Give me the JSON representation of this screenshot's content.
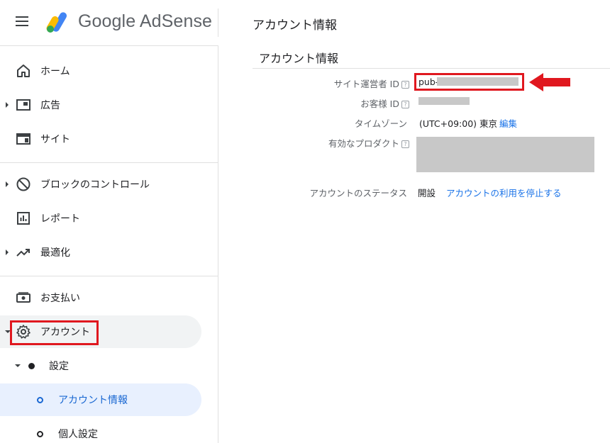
{
  "app": {
    "logo_text": "Google AdSense"
  },
  "header": {
    "title": "アカウント情報"
  },
  "sidebar": {
    "items": [
      {
        "label": "ホーム",
        "icon": "home-icon"
      },
      {
        "label": "広告",
        "icon": "ads-icon"
      },
      {
        "label": "サイト",
        "icon": "sites-icon"
      },
      {
        "label": "ブロックのコントロール",
        "icon": "block-icon"
      },
      {
        "label": "レポート",
        "icon": "report-icon"
      },
      {
        "label": "最適化",
        "icon": "trending-icon"
      },
      {
        "label": "お支払い",
        "icon": "payment-icon"
      },
      {
        "label": "アカウント",
        "icon": "gear-icon"
      }
    ],
    "sub_group": "設定",
    "sub_items": [
      {
        "label": "アカウント情報"
      },
      {
        "label": "個人設定"
      }
    ]
  },
  "main": {
    "title": "アカウント情報",
    "publisher_id_label": "サイト運営者 ID",
    "publisher_id_prefix": "pub-",
    "customer_id_label": "お客様 ID",
    "timezone_label": "タイムゾーン",
    "timezone_value": "(UTC+09:00) 東京",
    "timezone_edit": "編集",
    "products_label": "有効なプロダクト",
    "status_label": "アカウントのステータス",
    "status_value": "開設",
    "status_link": "アカウントの利用を停止する",
    "help_glyph": "?"
  },
  "colors": {
    "highlight": "#e0181f",
    "link": "#1a73e8",
    "selected_bg": "#e8f0fe",
    "redacted": "#c8c8c8"
  }
}
